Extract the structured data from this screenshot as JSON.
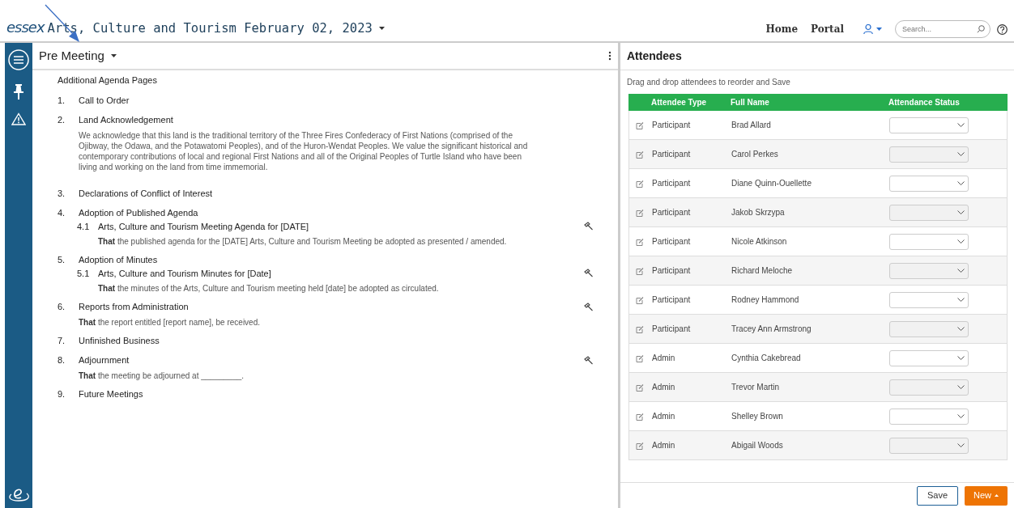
{
  "header": {
    "logo": "essex",
    "title": "Arts, Culture and Tourism February 02, 2023",
    "nav": [
      "Home",
      "Portal"
    ],
    "search": {
      "placeholder": "Search..."
    }
  },
  "agenda": {
    "title": "Pre Meeting",
    "section_label": "Additional Agenda Pages",
    "items": [
      {
        "number": "1.",
        "title": "Call to Order",
        "gavel": false
      },
      {
        "number": "2.",
        "title": "Land Acknowledgement",
        "gavel": false,
        "text": "We acknowledge that this land is the traditional territory of the Three Fires Confederacy of First Nations (comprised of the Ojibway, the Odawa, and the Potawatomi Peoples), and of the Huron-Wendat Peoples. We value the significant historical and contemporary contributions of local and regional First Nations and all of the Original Peoples of Turtle Island who have been living and working on the land from time immemorial."
      },
      {
        "number": "3.",
        "title": "Declarations of Conflict of Interest",
        "gavel": false
      },
      {
        "number": "4.",
        "title": "Adoption of Published Agenda",
        "gavel": false,
        "children": [
          {
            "number": "4.1",
            "title": "Arts, Culture and Tourism Meeting Agenda for [DATE]",
            "gavel": true,
            "text": "**That** the published agenda for the [DATE] Arts, Culture and Tourism Meeting be adopted as presented / amended."
          }
        ]
      },
      {
        "number": "5.",
        "title": "Adoption of Minutes",
        "gavel": false,
        "children": [
          {
            "number": "5.1",
            "title": "Arts, Culture and Tourism Minutes for [Date]",
            "gavel": true,
            "text": "**That** the minutes of the Arts, Culture and Tourism meeting held [date] be adopted as circulated."
          }
        ]
      },
      {
        "number": "6.",
        "title": "Reports from Administration",
        "gavel": true,
        "text": "**That** the report entitled [report name], be received."
      },
      {
        "number": "7.",
        "title": "Unfinished Business",
        "gavel": false
      },
      {
        "number": "8.",
        "title": "Adjournment",
        "gavel": true,
        "text": "**That** the meeting be adjourned at _________."
      },
      {
        "number": "9.",
        "title": "Future Meetings",
        "gavel": false
      }
    ]
  },
  "attendees": {
    "title": "Attendees",
    "hint": "Drag and drop attendees to reorder and Save",
    "columns": [
      "Attendee Type",
      "Full Name",
      "Attendance Status"
    ],
    "rows": [
      {
        "type": "Participant",
        "name": "Brad Allard"
      },
      {
        "type": "Participant",
        "name": "Carol Perkes"
      },
      {
        "type": "Participant",
        "name": "Diane Quinn-Ouellette"
      },
      {
        "type": "Participant",
        "name": "Jakob Skrzypa"
      },
      {
        "type": "Participant",
        "name": "Nicole Atkinson"
      },
      {
        "type": "Participant",
        "name": "Richard Meloche"
      },
      {
        "type": "Participant",
        "name": "Rodney Hammond"
      },
      {
        "type": "Participant",
        "name": "Tracey Ann Armstrong"
      },
      {
        "type": "Admin",
        "name": "Cynthia Cakebread"
      },
      {
        "type": "Admin",
        "name": "Trevor Martin"
      },
      {
        "type": "Admin",
        "name": "Shelley Brown"
      },
      {
        "type": "Admin",
        "name": "Abigail Woods"
      }
    ],
    "buttons": [
      {
        "label": "Save",
        "kind": "outline"
      },
      {
        "label": "New",
        "kind": "primary"
      }
    ]
  }
}
